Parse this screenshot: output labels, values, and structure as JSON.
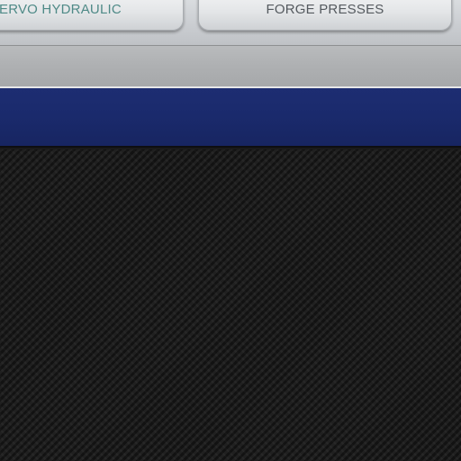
{
  "nav": {
    "buttons": [
      {
        "label": "ERVO HYDRAULIC",
        "text_color": "#4f8a87"
      },
      {
        "label": "FORGE PRESSES",
        "text_color": "#555a5f"
      }
    ]
  },
  "colors": {
    "blue_band": "#1a2a6c",
    "grey_band": "#aeb0b2",
    "background": "#1b1b1b"
  }
}
